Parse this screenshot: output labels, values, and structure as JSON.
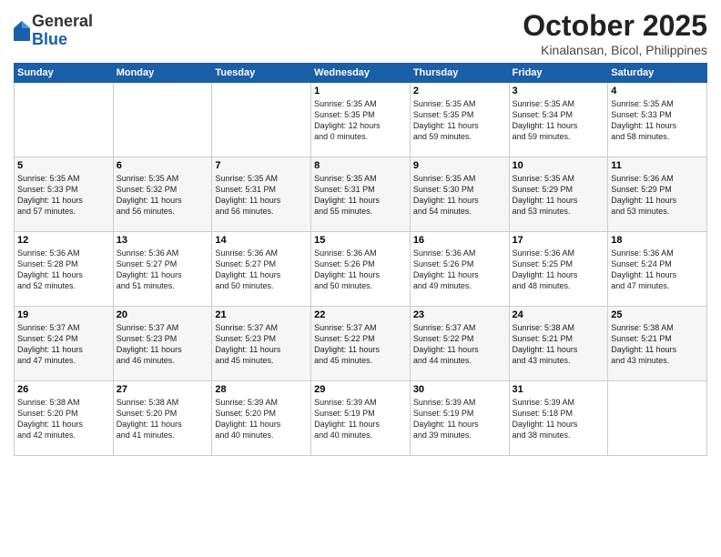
{
  "logo": {
    "general": "General",
    "blue": "Blue"
  },
  "header": {
    "month": "October 2025",
    "location": "Kinalansan, Bicol, Philippines"
  },
  "weekdays": [
    "Sunday",
    "Monday",
    "Tuesday",
    "Wednesday",
    "Thursday",
    "Friday",
    "Saturday"
  ],
  "weeks": [
    [
      {
        "day": "",
        "info": ""
      },
      {
        "day": "",
        "info": ""
      },
      {
        "day": "",
        "info": ""
      },
      {
        "day": "1",
        "info": "Sunrise: 5:35 AM\nSunset: 5:35 PM\nDaylight: 12 hours\nand 0 minutes."
      },
      {
        "day": "2",
        "info": "Sunrise: 5:35 AM\nSunset: 5:35 PM\nDaylight: 11 hours\nand 59 minutes."
      },
      {
        "day": "3",
        "info": "Sunrise: 5:35 AM\nSunset: 5:34 PM\nDaylight: 11 hours\nand 59 minutes."
      },
      {
        "day": "4",
        "info": "Sunrise: 5:35 AM\nSunset: 5:33 PM\nDaylight: 11 hours\nand 58 minutes."
      }
    ],
    [
      {
        "day": "5",
        "info": "Sunrise: 5:35 AM\nSunset: 5:33 PM\nDaylight: 11 hours\nand 57 minutes."
      },
      {
        "day": "6",
        "info": "Sunrise: 5:35 AM\nSunset: 5:32 PM\nDaylight: 11 hours\nand 56 minutes."
      },
      {
        "day": "7",
        "info": "Sunrise: 5:35 AM\nSunset: 5:31 PM\nDaylight: 11 hours\nand 56 minutes."
      },
      {
        "day": "8",
        "info": "Sunrise: 5:35 AM\nSunset: 5:31 PM\nDaylight: 11 hours\nand 55 minutes."
      },
      {
        "day": "9",
        "info": "Sunrise: 5:35 AM\nSunset: 5:30 PM\nDaylight: 11 hours\nand 54 minutes."
      },
      {
        "day": "10",
        "info": "Sunrise: 5:35 AM\nSunset: 5:29 PM\nDaylight: 11 hours\nand 53 minutes."
      },
      {
        "day": "11",
        "info": "Sunrise: 5:36 AM\nSunset: 5:29 PM\nDaylight: 11 hours\nand 53 minutes."
      }
    ],
    [
      {
        "day": "12",
        "info": "Sunrise: 5:36 AM\nSunset: 5:28 PM\nDaylight: 11 hours\nand 52 minutes."
      },
      {
        "day": "13",
        "info": "Sunrise: 5:36 AM\nSunset: 5:27 PM\nDaylight: 11 hours\nand 51 minutes."
      },
      {
        "day": "14",
        "info": "Sunrise: 5:36 AM\nSunset: 5:27 PM\nDaylight: 11 hours\nand 50 minutes."
      },
      {
        "day": "15",
        "info": "Sunrise: 5:36 AM\nSunset: 5:26 PM\nDaylight: 11 hours\nand 50 minutes."
      },
      {
        "day": "16",
        "info": "Sunrise: 5:36 AM\nSunset: 5:26 PM\nDaylight: 11 hours\nand 49 minutes."
      },
      {
        "day": "17",
        "info": "Sunrise: 5:36 AM\nSunset: 5:25 PM\nDaylight: 11 hours\nand 48 minutes."
      },
      {
        "day": "18",
        "info": "Sunrise: 5:36 AM\nSunset: 5:24 PM\nDaylight: 11 hours\nand 47 minutes."
      }
    ],
    [
      {
        "day": "19",
        "info": "Sunrise: 5:37 AM\nSunset: 5:24 PM\nDaylight: 11 hours\nand 47 minutes."
      },
      {
        "day": "20",
        "info": "Sunrise: 5:37 AM\nSunset: 5:23 PM\nDaylight: 11 hours\nand 46 minutes."
      },
      {
        "day": "21",
        "info": "Sunrise: 5:37 AM\nSunset: 5:23 PM\nDaylight: 11 hours\nand 45 minutes."
      },
      {
        "day": "22",
        "info": "Sunrise: 5:37 AM\nSunset: 5:22 PM\nDaylight: 11 hours\nand 45 minutes."
      },
      {
        "day": "23",
        "info": "Sunrise: 5:37 AM\nSunset: 5:22 PM\nDaylight: 11 hours\nand 44 minutes."
      },
      {
        "day": "24",
        "info": "Sunrise: 5:38 AM\nSunset: 5:21 PM\nDaylight: 11 hours\nand 43 minutes."
      },
      {
        "day": "25",
        "info": "Sunrise: 5:38 AM\nSunset: 5:21 PM\nDaylight: 11 hours\nand 43 minutes."
      }
    ],
    [
      {
        "day": "26",
        "info": "Sunrise: 5:38 AM\nSunset: 5:20 PM\nDaylight: 11 hours\nand 42 minutes."
      },
      {
        "day": "27",
        "info": "Sunrise: 5:38 AM\nSunset: 5:20 PM\nDaylight: 11 hours\nand 41 minutes."
      },
      {
        "day": "28",
        "info": "Sunrise: 5:39 AM\nSunset: 5:20 PM\nDaylight: 11 hours\nand 40 minutes."
      },
      {
        "day": "29",
        "info": "Sunrise: 5:39 AM\nSunset: 5:19 PM\nDaylight: 11 hours\nand 40 minutes."
      },
      {
        "day": "30",
        "info": "Sunrise: 5:39 AM\nSunset: 5:19 PM\nDaylight: 11 hours\nand 39 minutes."
      },
      {
        "day": "31",
        "info": "Sunrise: 5:39 AM\nSunset: 5:18 PM\nDaylight: 11 hours\nand 38 minutes."
      },
      {
        "day": "",
        "info": ""
      }
    ]
  ]
}
